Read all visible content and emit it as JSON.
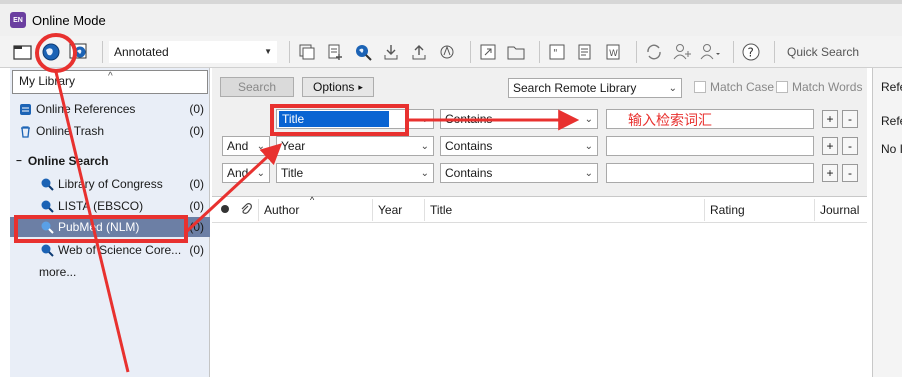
{
  "window": {
    "title": "Online Mode",
    "badge": "EN"
  },
  "toolbar": {
    "style_value": "Annotated",
    "quick_search": "Quick Search"
  },
  "left_panel": {
    "my_library": "My Library",
    "items": [
      {
        "label": "Online References",
        "count": "(0)"
      },
      {
        "label": "Online Trash",
        "count": "(0)"
      }
    ],
    "group_label": "Online Search",
    "search_items": [
      {
        "label": "Library of Congress",
        "count": "(0)"
      },
      {
        "label": "LISTA (EBSCO)",
        "count": "(0)"
      },
      {
        "label": "PubMed (NLM)",
        "count": "(0)"
      },
      {
        "label": "Web of Science Core...",
        "count": "(0)"
      }
    ],
    "more": "more..."
  },
  "search": {
    "search_button": "Search",
    "options_button": "Options",
    "options_arrow": "▸",
    "remote_library": "Search Remote Library",
    "match_case": "Match Case",
    "match_words": "Match Words",
    "rows": [
      {
        "bool": "",
        "field": "Title",
        "op": "Contains",
        "value": ""
      },
      {
        "bool": "And",
        "field": "Year",
        "op": "Contains",
        "value": ""
      },
      {
        "bool": "And",
        "field": "Title",
        "op": "Contains",
        "value": ""
      }
    ],
    "plus": "+",
    "minus": "-"
  },
  "results": {
    "columns": [
      "Author",
      "Year",
      "Title",
      "Rating",
      "Journal"
    ]
  },
  "right_panel": {
    "tab": "Refe",
    "line1": "Refe",
    "line2": "No I"
  },
  "annotation": {
    "text": "输入检索词汇"
  },
  "colors": {
    "highlight": "#e8312f",
    "selected_row": "#6c7fa5",
    "title_field_bg": "#0a64d2"
  }
}
